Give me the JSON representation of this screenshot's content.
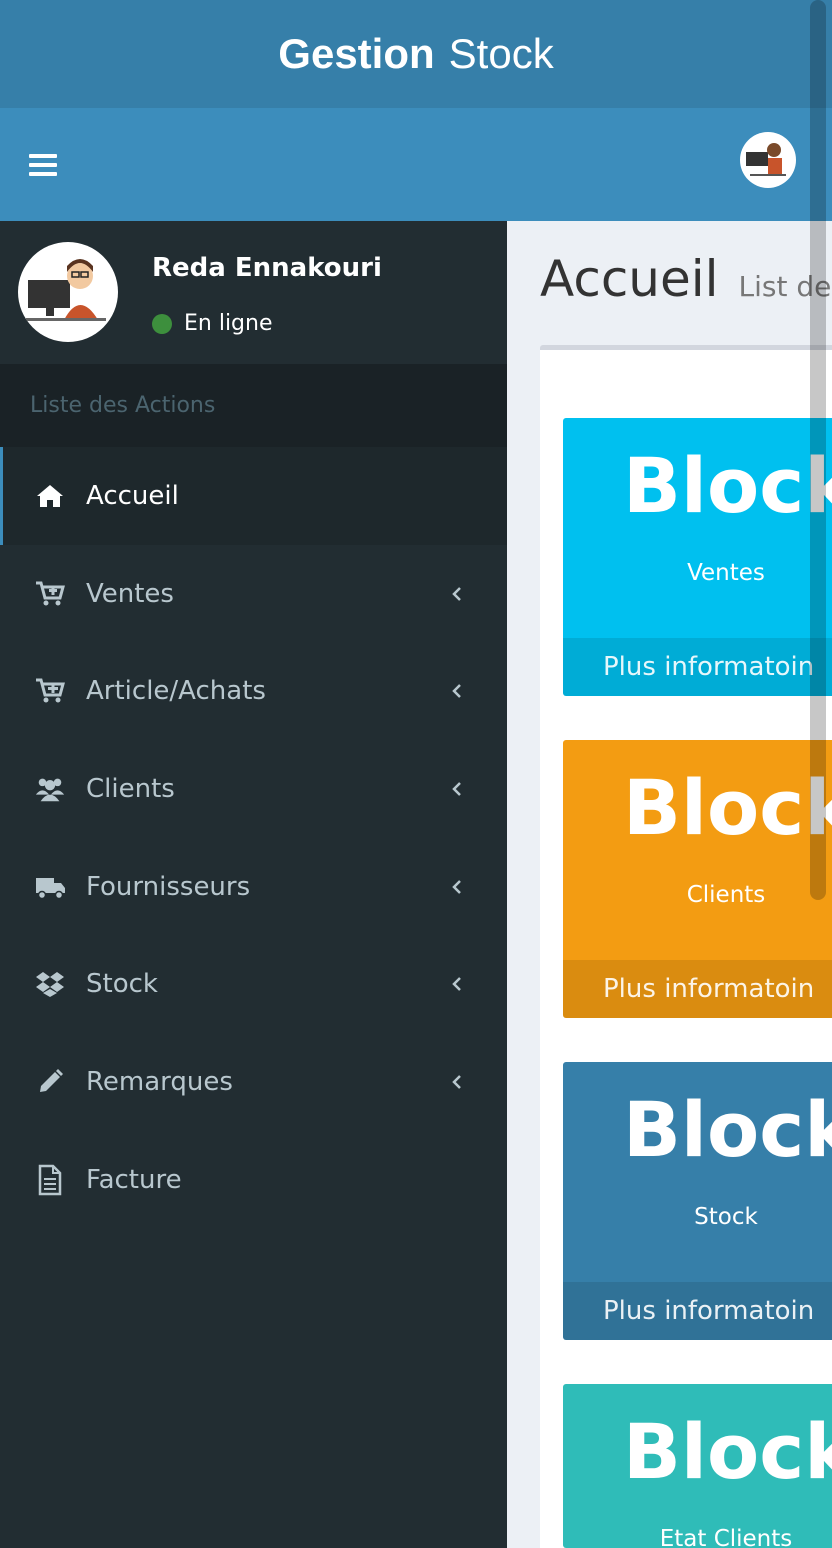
{
  "app": {
    "logo_bold": "Gestion",
    "logo_light": "Stock"
  },
  "user": {
    "name": "Reda Ennakouri",
    "status": "En ligne"
  },
  "sidebar": {
    "header": "Liste des Actions",
    "items": [
      {
        "label": "Accueil",
        "icon": "home-icon"
      },
      {
        "label": "Ventes",
        "icon": "cart-icon"
      },
      {
        "label": "Article/Achats",
        "icon": "cart-plus-icon"
      },
      {
        "label": "Clients",
        "icon": "users-icon"
      },
      {
        "label": "Fournisseurs",
        "icon": "truck-icon"
      },
      {
        "label": "Stock",
        "icon": "dropbox-icon"
      },
      {
        "label": "Remarques",
        "icon": "pencil-icon"
      },
      {
        "label": "Facture",
        "icon": "file-icon"
      }
    ]
  },
  "content": {
    "title": "Accueil",
    "subtitle": "List des c",
    "boxes": [
      {
        "number": "Block",
        "label": "Ventes",
        "footer": "Plus informatoin",
        "color": "#00c0ef"
      },
      {
        "number": "Block",
        "label": "Clients",
        "footer": "Plus informatoin",
        "color": "#f39c12"
      },
      {
        "number": "Block",
        "label": "Stock",
        "footer": "Plus informatoin",
        "color": "#367fa9"
      },
      {
        "number": "Block",
        "label": "Etat Clients",
        "footer": "",
        "color": "#2fbcb8"
      }
    ]
  }
}
